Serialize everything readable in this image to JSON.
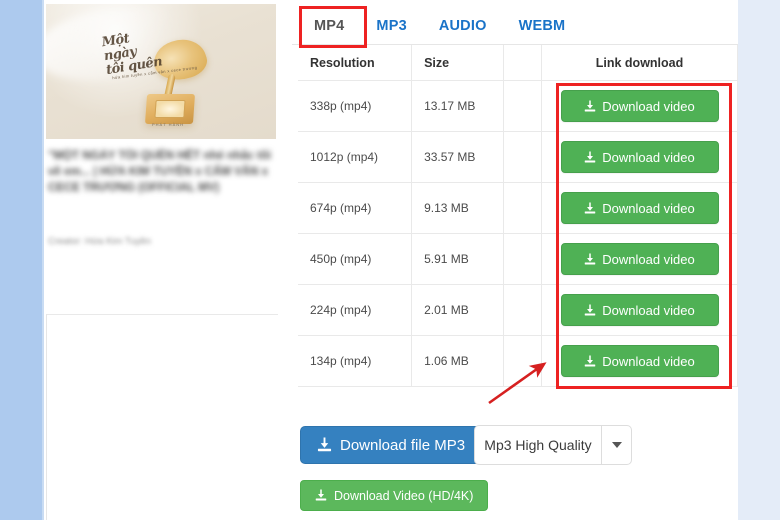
{
  "theme": {
    "band_left": "#adcaee",
    "band_right": "#e4ecf8",
    "tab_link": "#1a73c8",
    "tab_active": "#555555",
    "green_button": "#4fb155",
    "blue_button": "#3581c0",
    "hd_button": "#5cb85c",
    "annotation_red": "#ee2222",
    "table_border": "#e9e9e9"
  },
  "video": {
    "title": "\"MỘT NGÀY TÔI QUÊN HẾT nhé nhắc tôi về em... | HỨA KIM TUYỀN x CẨM VÂN x CECE TRƯƠNG (OFFICIAL MV)",
    "creator": "Creator: Hứa Kim Tuyền",
    "thumbnail_script_line1": "Một",
    "thumbnail_script_line2": "ngày",
    "thumbnail_script_line3": "tôi quên",
    "thumbnail_subscript": "hứa kim tuyền x cẩm vân x cece trương",
    "thumbnail_bottom_tag": "PHÁT HÀNH"
  },
  "tabs": [
    {
      "label": "MP4",
      "active": true
    },
    {
      "label": "MP3",
      "active": false
    },
    {
      "label": "AUDIO",
      "active": false
    },
    {
      "label": "WEBM",
      "active": false
    }
  ],
  "table": {
    "headers": {
      "resolution": "Resolution",
      "size": "Size",
      "link": "Link download"
    },
    "rows": [
      {
        "resolution": "338p (mp4)",
        "size": "13.17 MB",
        "button": "Download video"
      },
      {
        "resolution": "1012p (mp4)",
        "size": "33.57 MB",
        "button": "Download video"
      },
      {
        "resolution": "674p (mp4)",
        "size": "9.13 MB",
        "button": "Download video"
      },
      {
        "resolution": "450p (mp4)",
        "size": "5.91 MB",
        "button": "Download video"
      },
      {
        "resolution": "224p (mp4)",
        "size": "2.01 MB",
        "button": "Download video"
      },
      {
        "resolution": "134p (mp4)",
        "size": "1.06 MB",
        "button": "Download video"
      }
    ]
  },
  "actions": {
    "mp3_button": "Download file MP3",
    "quality_value": "Mp3 High Quality",
    "quality_caret_icon": "chevron-down-icon",
    "hd_button": "Download Video (HD/4K)",
    "download_icon": "download-icon"
  },
  "annotations": {
    "tab_highlight": "MP4",
    "buttons_highlight": "Link download column",
    "arrow": "points to last Download video button"
  }
}
